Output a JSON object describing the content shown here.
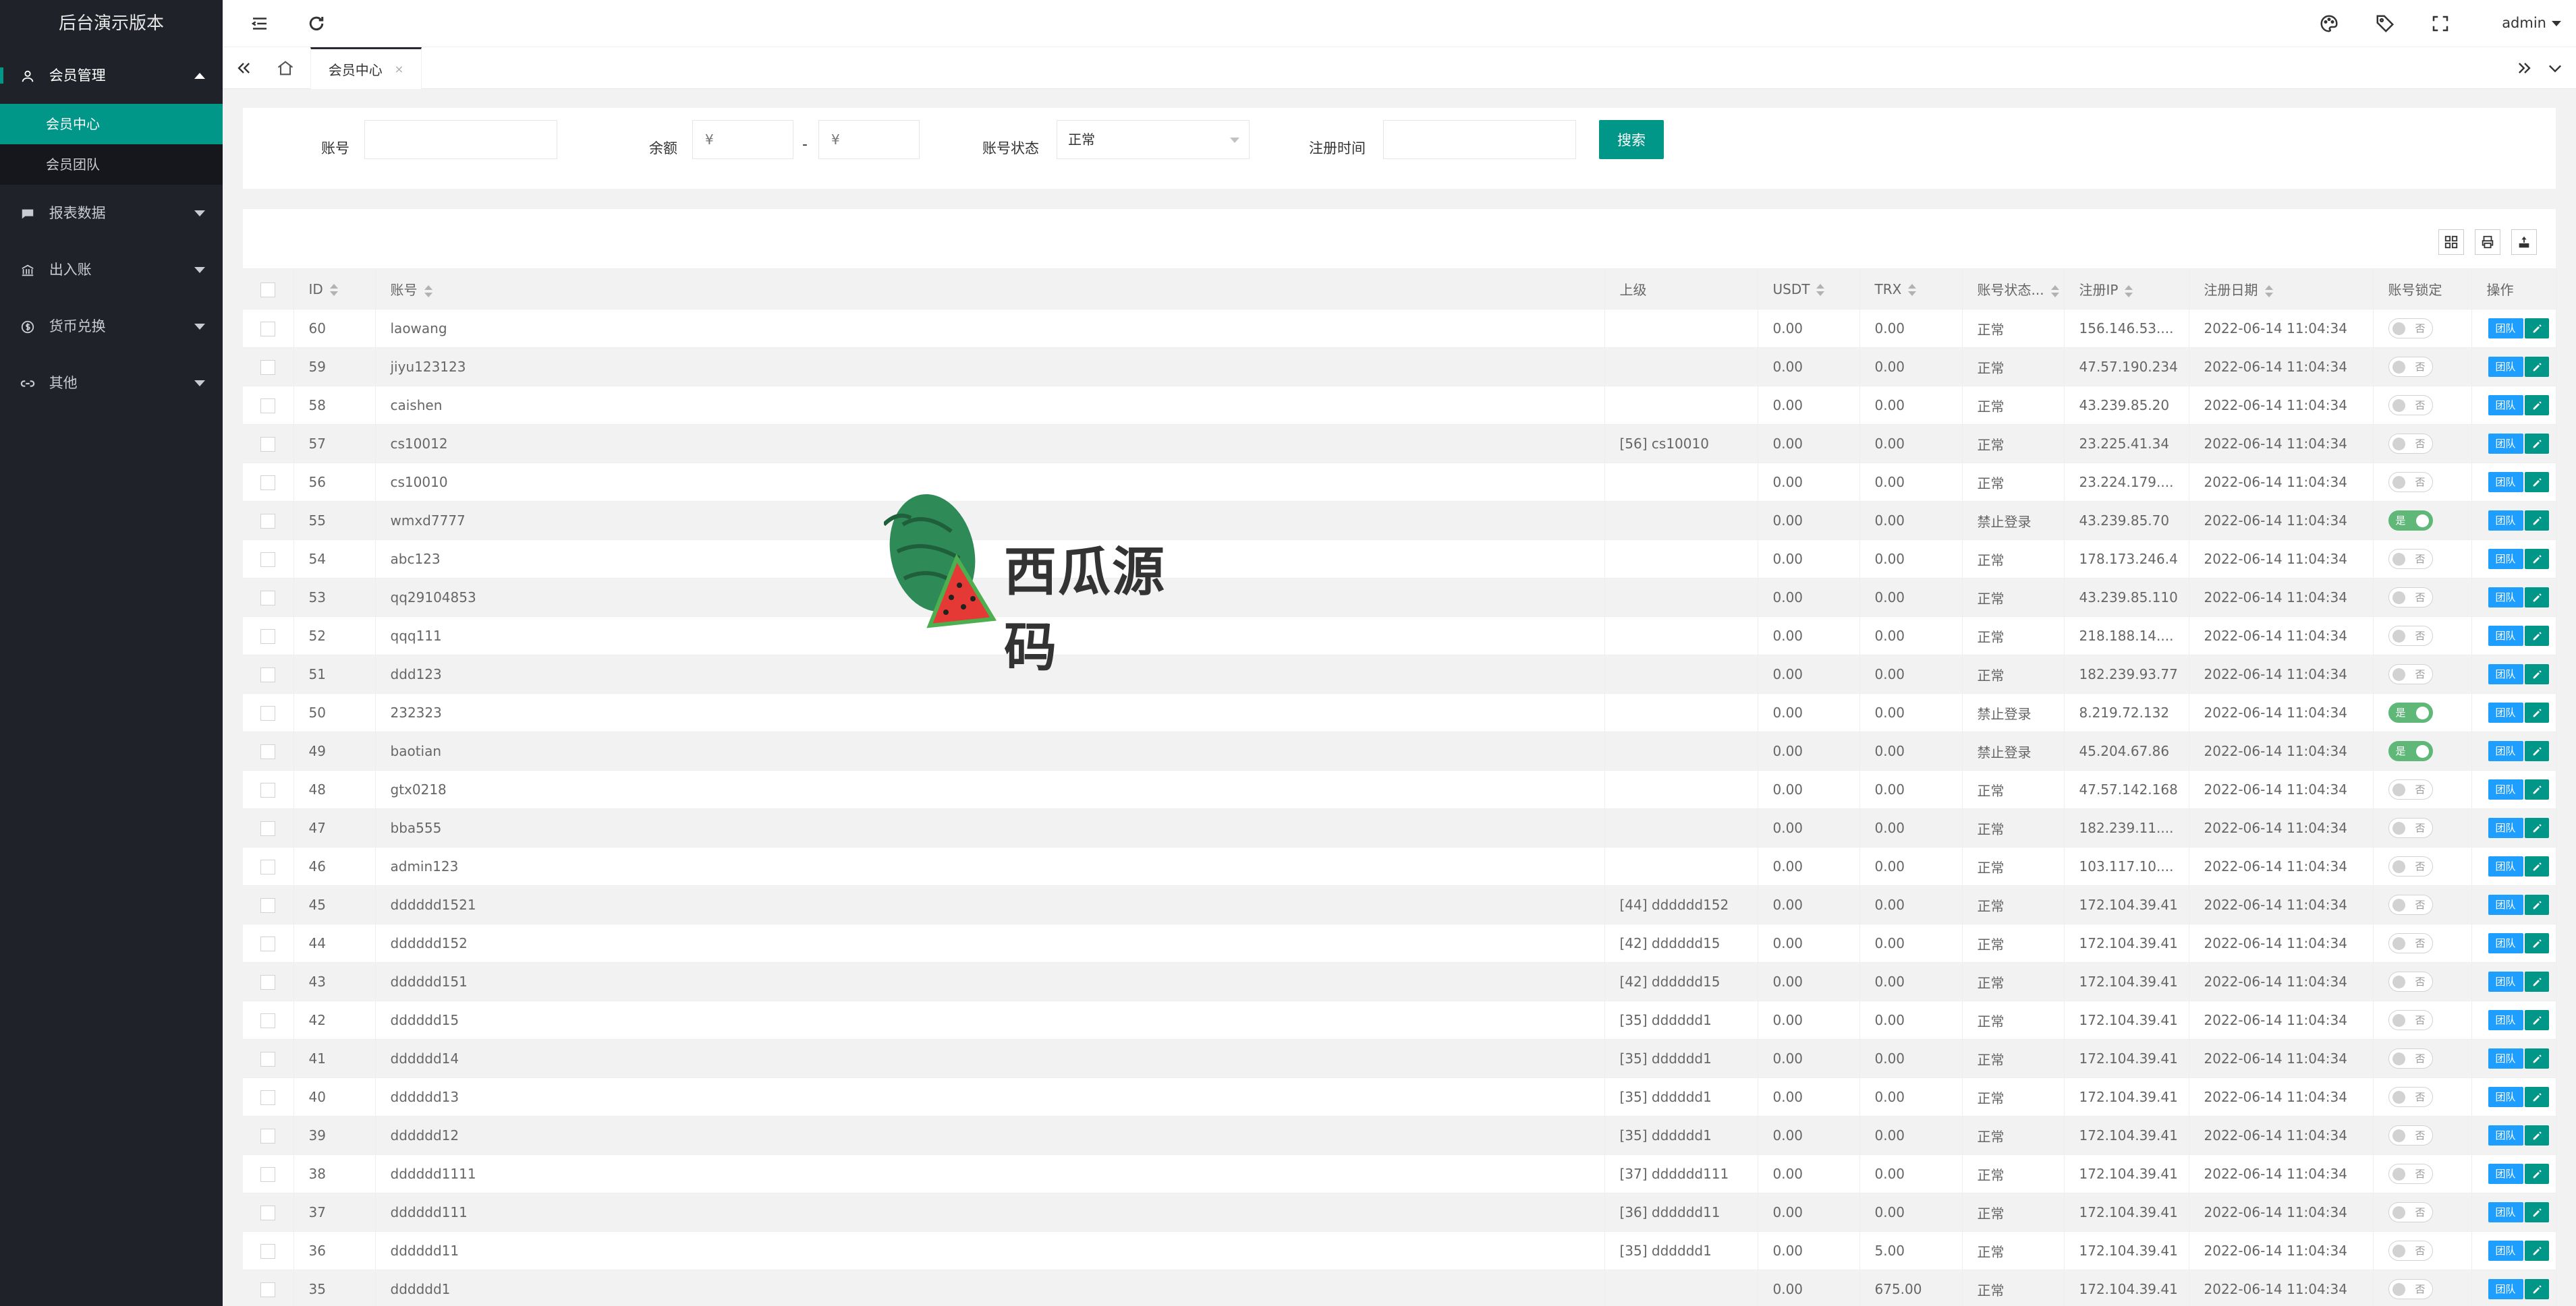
{
  "app": {
    "title": "后台演示版本"
  },
  "sidebar": {
    "items": [
      {
        "label": "会员管理",
        "icon": "user-icon",
        "open": true,
        "children": [
          {
            "label": "会员中心",
            "active": true
          },
          {
            "label": "会员团队",
            "active": false
          }
        ]
      },
      {
        "label": "报表数据",
        "icon": "chat-icon"
      },
      {
        "label": "出入账",
        "icon": "bank-icon"
      },
      {
        "label": "货币兑换",
        "icon": "dollar-icon"
      },
      {
        "label": "其他",
        "icon": "link-icon"
      }
    ]
  },
  "header": {
    "user": "admin"
  },
  "tabs": {
    "current": "会员中心",
    "close": "×"
  },
  "search": {
    "account_label": "账号",
    "account_value": "",
    "balance_label": "余额",
    "balance_min_placeholder": "¥",
    "balance_sep": "-",
    "balance_max_placeholder": "¥",
    "status_label": "账号状态",
    "status_value": "正常",
    "regtime_label": "注册时间",
    "regtime_value": "",
    "search_button": "搜索"
  },
  "table": {
    "columns": [
      "ID",
      "账号",
      "上级",
      "USDT",
      "TRX",
      "账号状态...",
      "注册IP",
      "注册日期",
      "账号锁定",
      "操作"
    ],
    "switch_on": "是",
    "switch_off": "否",
    "team_button": "团队",
    "rows": [
      {
        "id": "60",
        "account": "laowang",
        "parent": "",
        "usdt": "0.00",
        "trx": "0.00",
        "status": "正常",
        "ip": "156.146.53....",
        "date": "2022-06-14 11:04:34",
        "locked": false
      },
      {
        "id": "59",
        "account": "jiyu123123",
        "parent": "",
        "usdt": "0.00",
        "trx": "0.00",
        "status": "正常",
        "ip": "47.57.190.234",
        "date": "2022-06-14 11:04:34",
        "locked": false
      },
      {
        "id": "58",
        "account": "caishen",
        "parent": "",
        "usdt": "0.00",
        "trx": "0.00",
        "status": "正常",
        "ip": "43.239.85.20",
        "date": "2022-06-14 11:04:34",
        "locked": false
      },
      {
        "id": "57",
        "account": "cs10012",
        "parent": "[56] cs10010",
        "usdt": "0.00",
        "trx": "0.00",
        "status": "正常",
        "ip": "23.225.41.34",
        "date": "2022-06-14 11:04:34",
        "locked": false
      },
      {
        "id": "56",
        "account": "cs10010",
        "parent": "",
        "usdt": "0.00",
        "trx": "0.00",
        "status": "正常",
        "ip": "23.224.179....",
        "date": "2022-06-14 11:04:34",
        "locked": false
      },
      {
        "id": "55",
        "account": "wmxd7777",
        "parent": "",
        "usdt": "0.00",
        "trx": "0.00",
        "status": "禁止登录",
        "ip": "43.239.85.70",
        "date": "2022-06-14 11:04:34",
        "locked": true
      },
      {
        "id": "54",
        "account": "abc123",
        "parent": "",
        "usdt": "0.00",
        "trx": "0.00",
        "status": "正常",
        "ip": "178.173.246.4",
        "date": "2022-06-14 11:04:34",
        "locked": false
      },
      {
        "id": "53",
        "account": "qq29104853",
        "parent": "",
        "usdt": "0.00",
        "trx": "0.00",
        "status": "正常",
        "ip": "43.239.85.110",
        "date": "2022-06-14 11:04:34",
        "locked": false
      },
      {
        "id": "52",
        "account": "qqq111",
        "parent": "",
        "usdt": "0.00",
        "trx": "0.00",
        "status": "正常",
        "ip": "218.188.14....",
        "date": "2022-06-14 11:04:34",
        "locked": false
      },
      {
        "id": "51",
        "account": "ddd123",
        "parent": "",
        "usdt": "0.00",
        "trx": "0.00",
        "status": "正常",
        "ip": "182.239.93.77",
        "date": "2022-06-14 11:04:34",
        "locked": false
      },
      {
        "id": "50",
        "account": "232323",
        "parent": "",
        "usdt": "0.00",
        "trx": "0.00",
        "status": "禁止登录",
        "ip": "8.219.72.132",
        "date": "2022-06-14 11:04:34",
        "locked": true
      },
      {
        "id": "49",
        "account": "baotian",
        "parent": "",
        "usdt": "0.00",
        "trx": "0.00",
        "status": "禁止登录",
        "ip": "45.204.67.86",
        "date": "2022-06-14 11:04:34",
        "locked": true
      },
      {
        "id": "48",
        "account": "gtx0218",
        "parent": "",
        "usdt": "0.00",
        "trx": "0.00",
        "status": "正常",
        "ip": "47.57.142.168",
        "date": "2022-06-14 11:04:34",
        "locked": false
      },
      {
        "id": "47",
        "account": "bba555",
        "parent": "",
        "usdt": "0.00",
        "trx": "0.00",
        "status": "正常",
        "ip": "182.239.11....",
        "date": "2022-06-14 11:04:34",
        "locked": false
      },
      {
        "id": "46",
        "account": "admin123",
        "parent": "",
        "usdt": "0.00",
        "trx": "0.00",
        "status": "正常",
        "ip": "103.117.10....",
        "date": "2022-06-14 11:04:34",
        "locked": false
      },
      {
        "id": "45",
        "account": "dddddd1521",
        "parent": "[44] dddddd152",
        "usdt": "0.00",
        "trx": "0.00",
        "status": "正常",
        "ip": "172.104.39.41",
        "date": "2022-06-14 11:04:34",
        "locked": false
      },
      {
        "id": "44",
        "account": "dddddd152",
        "parent": "[42] dddddd15",
        "usdt": "0.00",
        "trx": "0.00",
        "status": "正常",
        "ip": "172.104.39.41",
        "date": "2022-06-14 11:04:34",
        "locked": false
      },
      {
        "id": "43",
        "account": "dddddd151",
        "parent": "[42] dddddd15",
        "usdt": "0.00",
        "trx": "0.00",
        "status": "正常",
        "ip": "172.104.39.41",
        "date": "2022-06-14 11:04:34",
        "locked": false
      },
      {
        "id": "42",
        "account": "dddddd15",
        "parent": "[35] dddddd1",
        "usdt": "0.00",
        "trx": "0.00",
        "status": "正常",
        "ip": "172.104.39.41",
        "date": "2022-06-14 11:04:34",
        "locked": false
      },
      {
        "id": "41",
        "account": "dddddd14",
        "parent": "[35] dddddd1",
        "usdt": "0.00",
        "trx": "0.00",
        "status": "正常",
        "ip": "172.104.39.41",
        "date": "2022-06-14 11:04:34",
        "locked": false
      },
      {
        "id": "40",
        "account": "dddddd13",
        "parent": "[35] dddddd1",
        "usdt": "0.00",
        "trx": "0.00",
        "status": "正常",
        "ip": "172.104.39.41",
        "date": "2022-06-14 11:04:34",
        "locked": false
      },
      {
        "id": "39",
        "account": "dddddd12",
        "parent": "[35] dddddd1",
        "usdt": "0.00",
        "trx": "0.00",
        "status": "正常",
        "ip": "172.104.39.41",
        "date": "2022-06-14 11:04:34",
        "locked": false
      },
      {
        "id": "38",
        "account": "dddddd1111",
        "parent": "[37] dddddd111",
        "usdt": "0.00",
        "trx": "0.00",
        "status": "正常",
        "ip": "172.104.39.41",
        "date": "2022-06-14 11:04:34",
        "locked": false
      },
      {
        "id": "37",
        "account": "dddddd111",
        "parent": "[36] dddddd11",
        "usdt": "0.00",
        "trx": "0.00",
        "status": "正常",
        "ip": "172.104.39.41",
        "date": "2022-06-14 11:04:34",
        "locked": false
      },
      {
        "id": "36",
        "account": "dddddd11",
        "parent": "[35] dddddd1",
        "usdt": "0.00",
        "trx": "5.00",
        "status": "正常",
        "ip": "172.104.39.41",
        "date": "2022-06-14 11:04:34",
        "locked": false
      },
      {
        "id": "35",
        "account": "dddddd1",
        "parent": "",
        "usdt": "0.00",
        "trx": "675.00",
        "status": "正常",
        "ip": "172.104.39.41",
        "date": "2022-06-14 11:04:34",
        "locked": false
      }
    ]
  },
  "watermark": {
    "text": "西瓜源码"
  },
  "colors": {
    "sidebar_bg": "#20222a",
    "accent": "#009688",
    "team_button": "#1e9fff",
    "switch_on": "#5fb878"
  }
}
